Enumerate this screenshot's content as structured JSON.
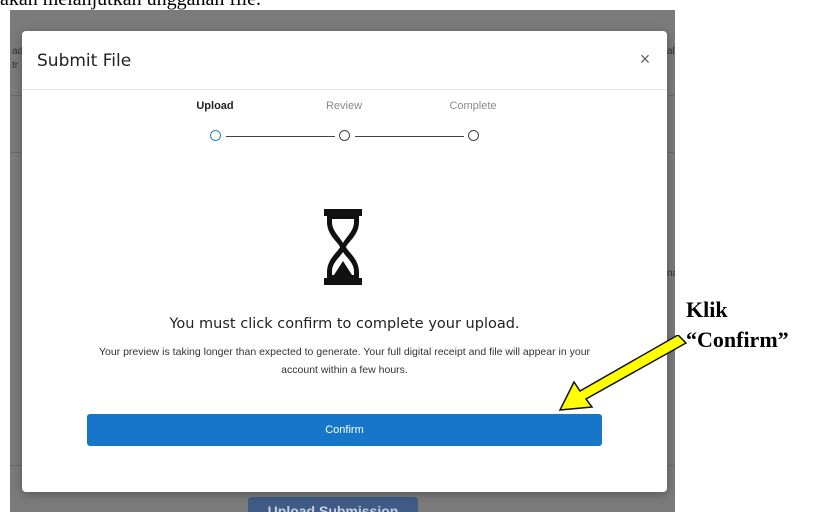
{
  "document": {
    "caption": "akan melanjutkan unggahan file."
  },
  "background": {
    "edge_left_1": "ad",
    "edge_left_2": "tr",
    "edge_right_1": "al",
    "edge_right_2": "na",
    "upload_submission_label": "Upload Submission"
  },
  "modal": {
    "title": "Submit File",
    "close_symbol": "×",
    "steps": [
      {
        "label": "Upload",
        "active": true
      },
      {
        "label": "Review",
        "active": false
      },
      {
        "label": "Complete",
        "active": false
      }
    ],
    "icon": "hourglass-icon",
    "message": "You must click confirm to complete your upload.",
    "detail": "Your preview is taking longer than expected to generate. Your full digital receipt and file will appear in your account within a few hours.",
    "confirm_label": "Confirm"
  },
  "annotation": {
    "line1": "Klik",
    "line2": "“Confirm”"
  },
  "colors": {
    "overlay": "#7b7b7b",
    "primary_button": "#1676c9",
    "active_step": "#2f80b8",
    "arrow_fill": "#ffff00"
  }
}
